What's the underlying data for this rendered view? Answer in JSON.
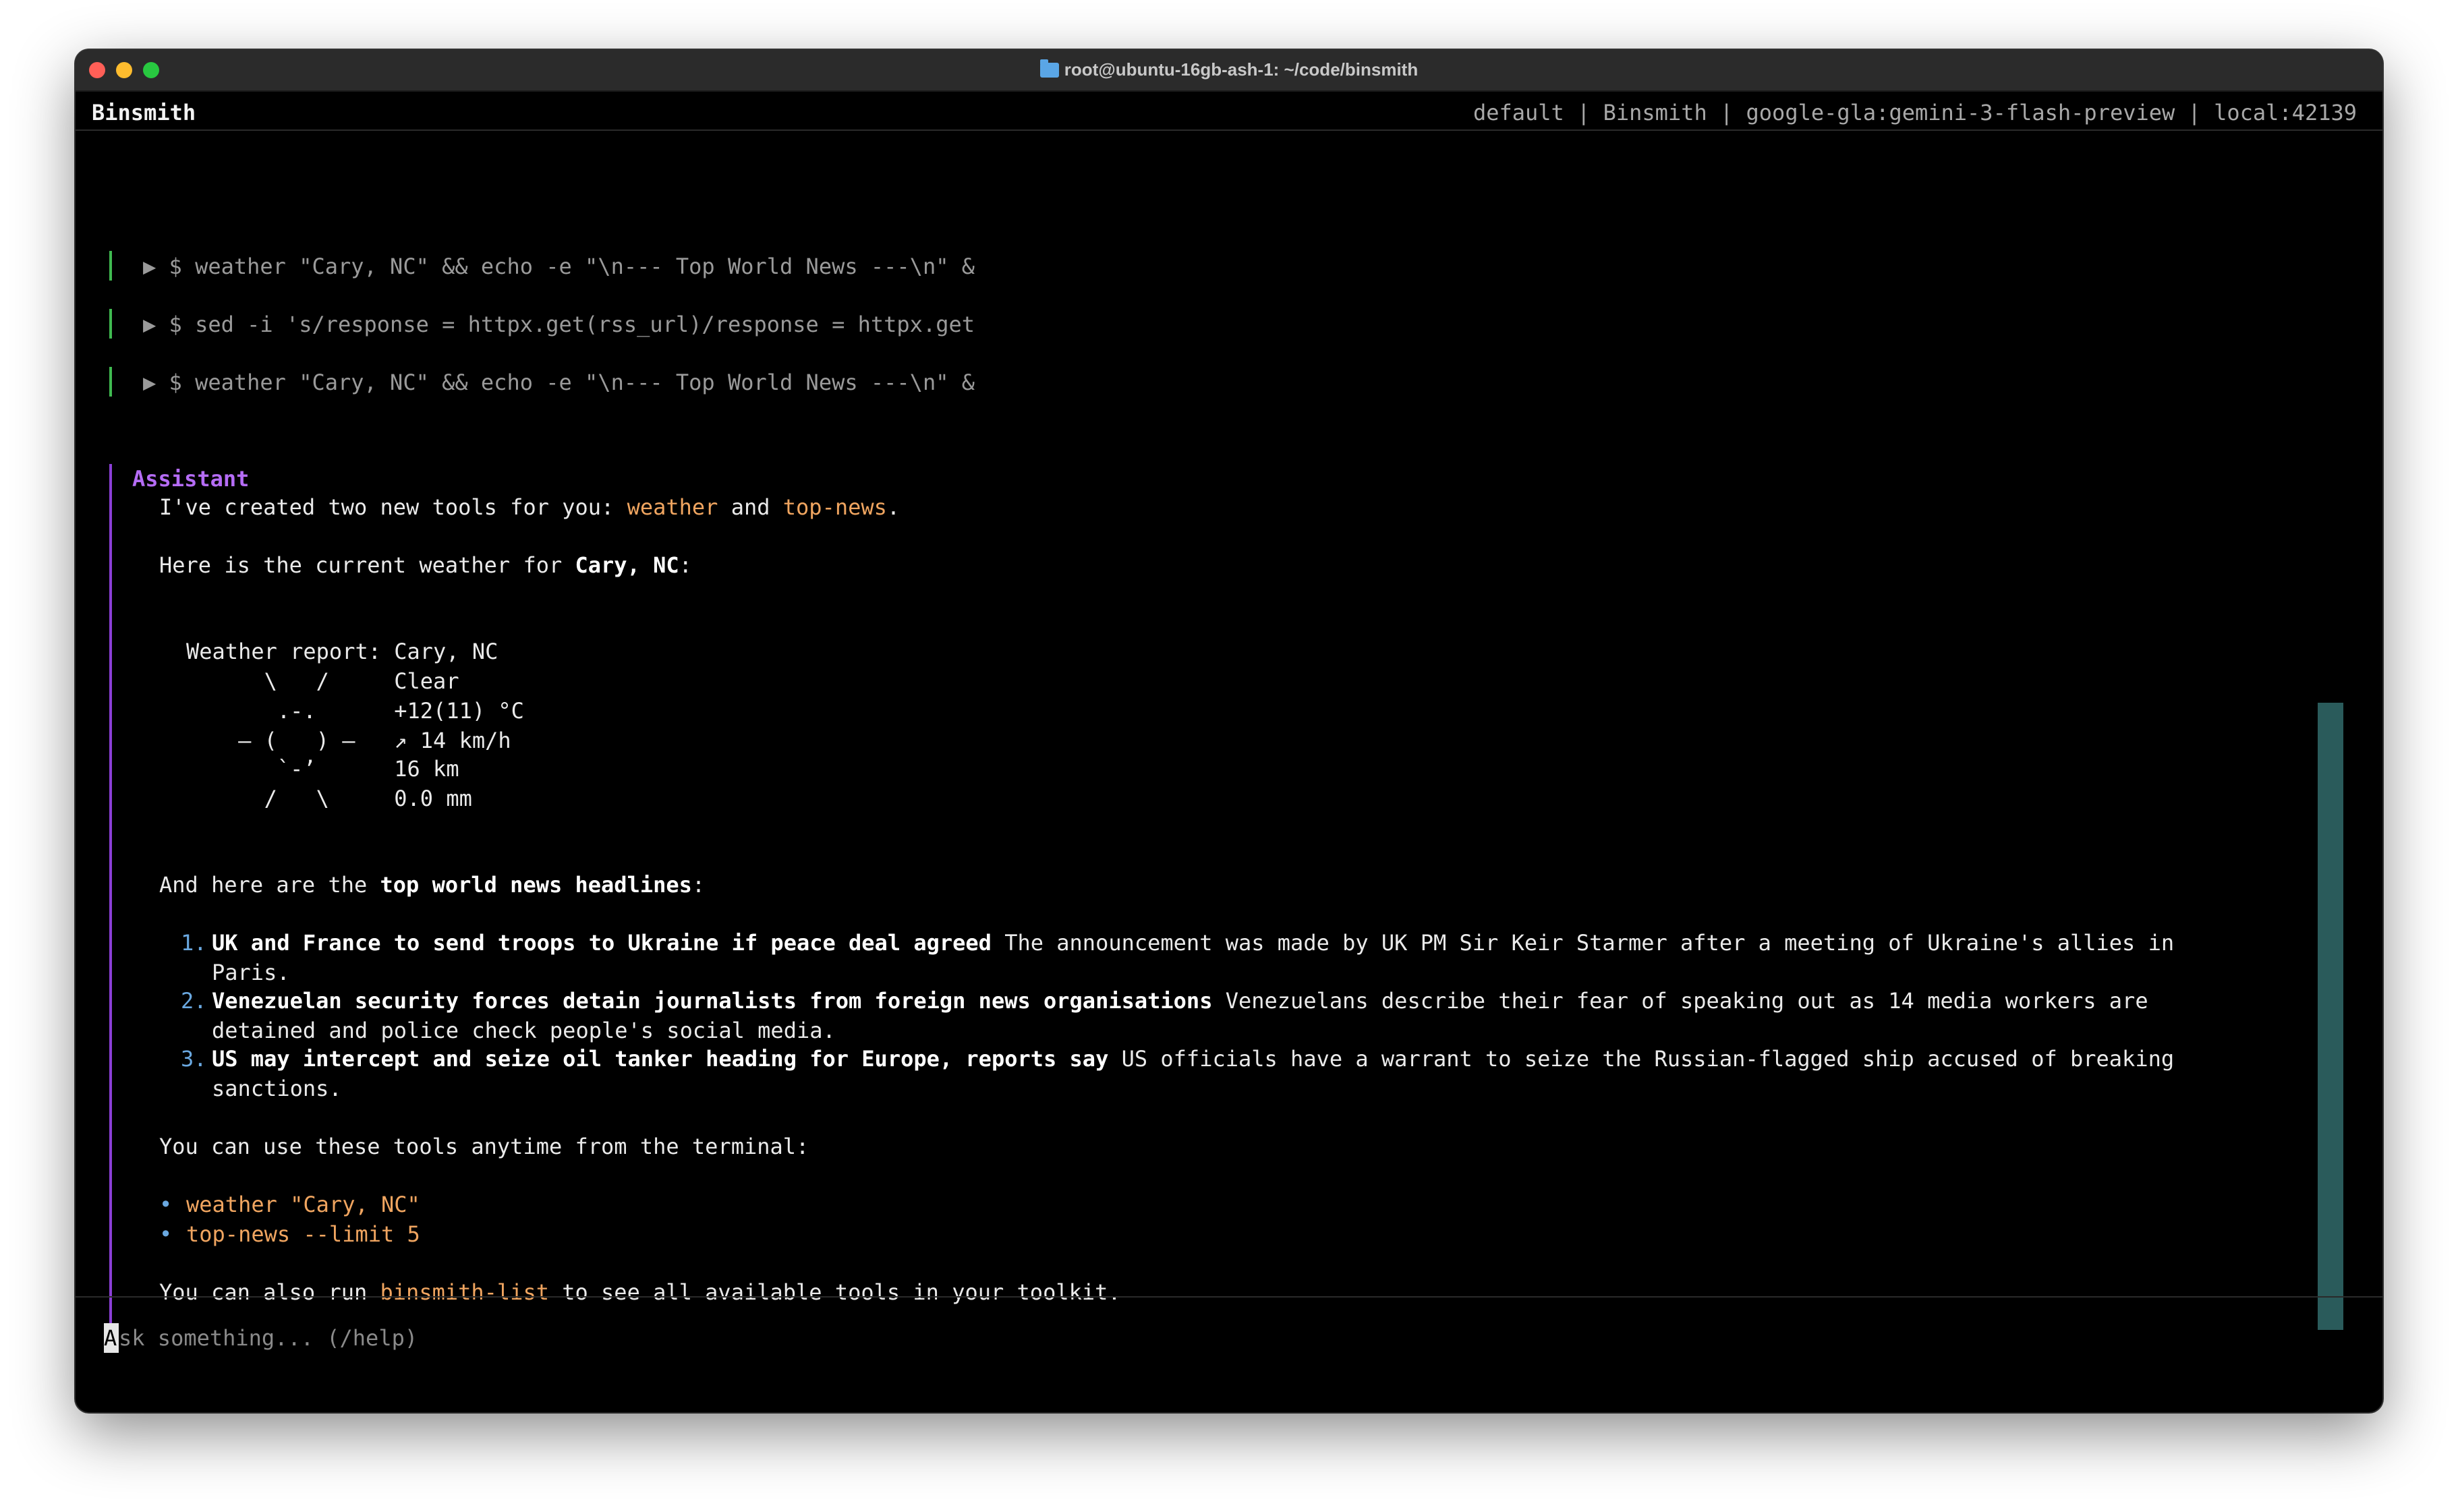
{
  "window": {
    "title": "root@ubuntu-16gb-ash-1: ~/code/binsmith"
  },
  "header": {
    "app_name": "Binsmith",
    "status": "default | Binsmith | google-gla:gemini-3-flash-preview | local:42139"
  },
  "tool_calls": [
    {
      "command": "▶ $ weather \"Cary, NC\" && echo -e \"\\n--- Top World News ---\\n\" &"
    },
    {
      "command": "▶ $ sed -i 's/response = httpx.get(rss_url)/response = httpx.get"
    },
    {
      "command": "▶ $ weather \"Cary, NC\" && echo -e \"\\n--- Top World News ---\\n\" &"
    }
  ],
  "assistant": {
    "role": "Assistant",
    "intro": {
      "prefix": "I've created two new tools for you: ",
      "tool1": "weather",
      "middle": " and ",
      "tool2": "top-news",
      "suffix": "."
    },
    "weather_intro": {
      "prefix": "Here is the current weather for ",
      "location": "Cary, NC",
      "suffix": ":"
    },
    "weather_report": [
      "Weather report: Cary, NC",
      "      \\   /     Clear",
      "       .-.      +12(11) °C",
      "    ― (   ) ―   ↗ 14 km/h",
      "       `-’      16 km",
      "      /   \\     0.0 mm"
    ],
    "news_intro": {
      "prefix": "And here are the ",
      "highlight": "top world news headlines",
      "suffix": ":"
    },
    "news": [
      {
        "number": "1.",
        "headline": "UK and France to send troops to Ukraine if peace deal agreed",
        "summary_line1": " The announcement was made by UK PM Sir Keir Starmer after a meeting of Ukraine's allies in",
        "summary_line2": "Paris."
      },
      {
        "number": "2.",
        "headline": "Venezuelan security forces detain journalists from foreign news organisations",
        "summary_line1": " Venezuelans describe their fear of speaking out as 14 media workers are",
        "summary_line2": "detained and police check people's social media."
      },
      {
        "number": "3.",
        "headline": "US may intercept and seize oil tanker heading for Europe, reports say",
        "summary_line1": " US officials have a warrant to seize the Russian-flagged ship accused of breaking",
        "summary_line2": "sanctions."
      }
    ],
    "usage_intro": "You can use these tools anytime from the terminal:",
    "usage_bullets": [
      {
        "bullet": "•",
        "text": "weather \"Cary, NC\""
      },
      {
        "bullet": "•",
        "text": "top-news --limit 5"
      }
    ],
    "closing": {
      "prefix": "You can also run ",
      "tool": "binsmith-list",
      "suffix": " to see all available tools in your toolkit."
    }
  },
  "input": {
    "cursor_char": "A",
    "placeholder_rest": "sk something... (/help)"
  },
  "colors": {
    "tool_bar": "#3fb950",
    "assistant_accent": "#b56cf5",
    "tool_name": "#f0a560",
    "list_number": "#6aa8e0",
    "scrollbar": "#2a5b5b"
  }
}
